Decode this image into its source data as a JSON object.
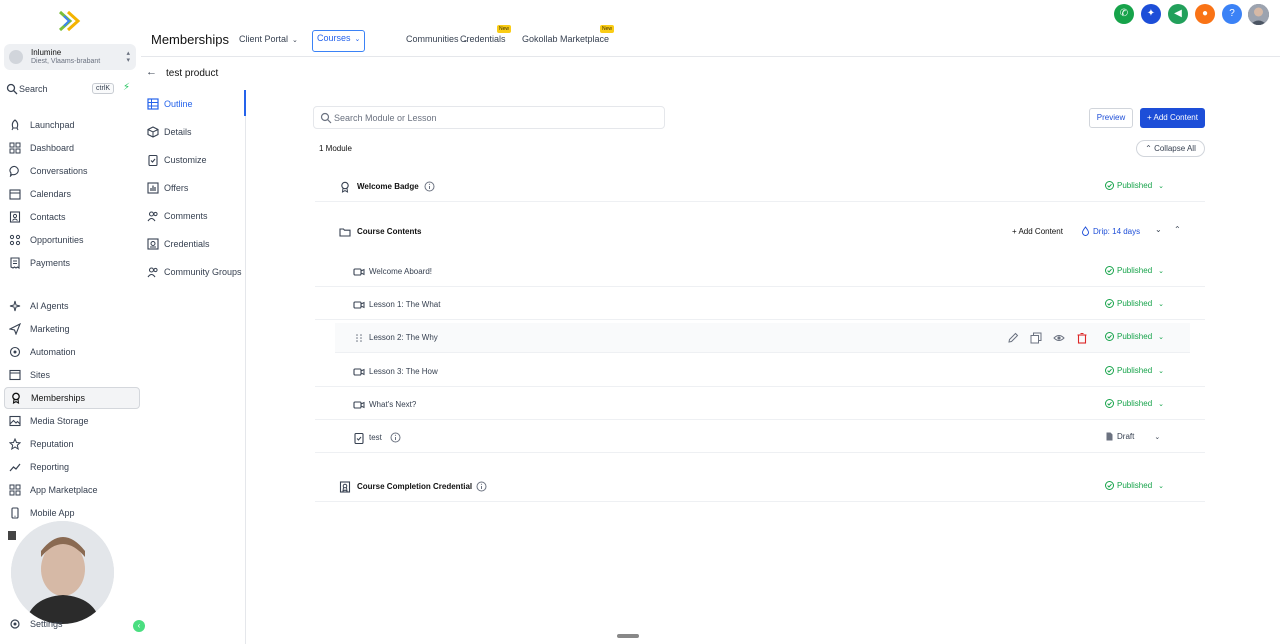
{
  "account": {
    "name": "Inlumine",
    "location": "Diest, Vlaams-brabant"
  },
  "sidebar_search": {
    "label": "Search",
    "shortcut": "ctrlK"
  },
  "sidebar": {
    "items": [
      {
        "label": "Launchpad",
        "icon": "rocket-icon"
      },
      {
        "label": "Dashboard",
        "icon": "grid-icon"
      },
      {
        "label": "Conversations",
        "icon": "chat-icon"
      },
      {
        "label": "Calendars",
        "icon": "calendar-icon"
      },
      {
        "label": "Contacts",
        "icon": "contacts-icon"
      },
      {
        "label": "Opportunities",
        "icon": "funnel-icon"
      },
      {
        "label": "Payments",
        "icon": "receipt-icon"
      },
      {
        "label": "AI Agents",
        "icon": "sparkle-icon"
      },
      {
        "label": "Marketing",
        "icon": "send-icon"
      },
      {
        "label": "Automation",
        "icon": "automation-icon"
      },
      {
        "label": "Sites",
        "icon": "sites-icon"
      },
      {
        "label": "Memberships",
        "icon": "membership-icon"
      },
      {
        "label": "Media Storage",
        "icon": "image-icon"
      },
      {
        "label": "Reputation",
        "icon": "star-icon"
      },
      {
        "label": "Reporting",
        "icon": "chart-icon"
      },
      {
        "label": "App Marketplace",
        "icon": "apps-icon"
      },
      {
        "label": "Mobile App",
        "icon": "mobile-icon"
      }
    ],
    "settings_label": "Settings"
  },
  "header": {
    "title": "Memberships",
    "tabs": [
      {
        "label": "Client Portal",
        "dropdown": true
      },
      {
        "label": "Courses",
        "dropdown": true
      },
      {
        "label": "Communities",
        "dropdown": true
      },
      {
        "label": "Credentials",
        "badge": "New"
      },
      {
        "label": "Gokollab Marketplace",
        "badge": "New"
      }
    ]
  },
  "product": {
    "title": "test product"
  },
  "subnav": [
    {
      "label": "Outline"
    },
    {
      "label": "Details"
    },
    {
      "label": "Customize"
    },
    {
      "label": "Offers"
    },
    {
      "label": "Comments"
    },
    {
      "label": "Credentials"
    },
    {
      "label": "Community Groups"
    }
  ],
  "main": {
    "search_placeholder": "Search Module or Lesson",
    "preview_label": "Preview",
    "add_content_label": "+ Add Content",
    "module_count": "1 Module",
    "collapse_label": "Collapse All",
    "welcome_badge": {
      "name": "Welcome Badge",
      "status": "Published"
    },
    "course_contents": {
      "name": "Course Contents",
      "add_label": "+ Add Content",
      "drip_label": "Drip: 14 days"
    },
    "lessons": [
      {
        "name": "Welcome Aboard!",
        "status": "Published",
        "icon": "video-icon"
      },
      {
        "name": "Lesson 1: The What",
        "status": "Published",
        "icon": "video-icon"
      },
      {
        "name": "Lesson 2: The Why",
        "status": "Published",
        "icon": "drag-handle-icon"
      },
      {
        "name": "Lesson 3: The How",
        "status": "Published",
        "icon": "video-icon"
      },
      {
        "name": "What's Next?",
        "status": "Published",
        "icon": "video-icon"
      },
      {
        "name": "test",
        "status": "Draft",
        "icon": "quiz-icon"
      }
    ],
    "credential": {
      "name": "Course Completion Credential",
      "status": "Published"
    }
  },
  "colors": {
    "accent": "#1d4ed8",
    "published": "#16a34a",
    "delete": "#dc2626"
  }
}
